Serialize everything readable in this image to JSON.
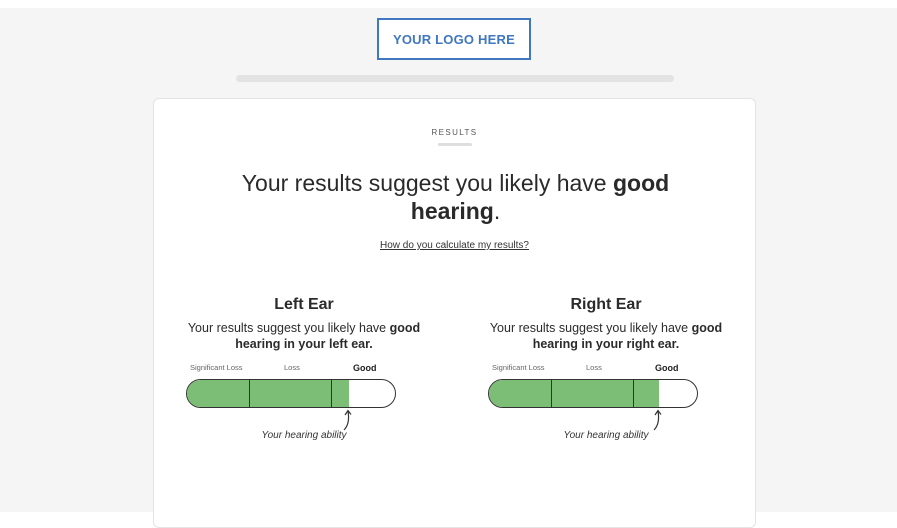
{
  "logo": {
    "text": "YOUR LOGO HERE"
  },
  "results": {
    "eyebrow": "RESULTS",
    "headline_pre": "Your results suggest you likely have ",
    "headline_bold": "good hearing",
    "headline_post": ".",
    "calc_link": "How do you calculate my results?"
  },
  "scale_labels": {
    "significant_loss": "Significant Loss",
    "loss": "Loss",
    "good": "Good"
  },
  "left_ear": {
    "title": "Left Ear",
    "desc_pre": "Your results suggest you likely have ",
    "desc_bold": "good hearing in your left ear.",
    "hearing_level": 0.77,
    "caption": "Your hearing ability"
  },
  "right_ear": {
    "title": "Right Ear",
    "desc_pre": "Your results suggest you likely have ",
    "desc_bold": "good hearing in your right ear.",
    "hearing_level": 0.81,
    "caption": "Your hearing ability"
  },
  "colors": {
    "accent": "#3f77c0",
    "good_fill": "#7dbe76"
  }
}
